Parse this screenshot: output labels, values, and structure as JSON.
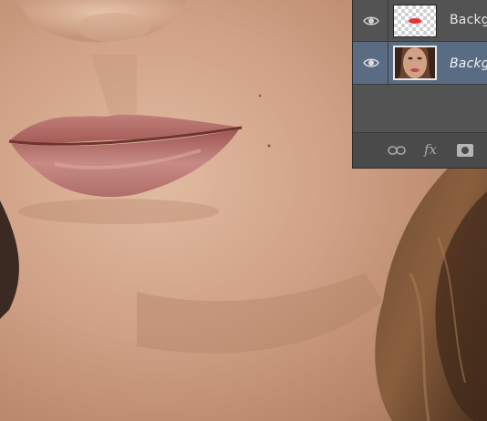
{
  "canvas": {
    "description_icon": "photo-canvas"
  },
  "layers_panel": {
    "layers": [
      {
        "name": "Backg",
        "visible": true,
        "thumbnail": "lip-mask-thumbnail",
        "selected": false
      },
      {
        "name": "Backg",
        "visible": true,
        "thumbnail": "face-photo-thumbnail",
        "selected": true
      }
    ],
    "footer": {
      "link_icon": "link-icon",
      "fx_label": "fx",
      "mask_icon": "add-mask-icon"
    }
  },
  "colors": {
    "panel_bg": "#535353",
    "selected_layer_bg": "#596c83",
    "lip_overlay": "#e0343a"
  }
}
